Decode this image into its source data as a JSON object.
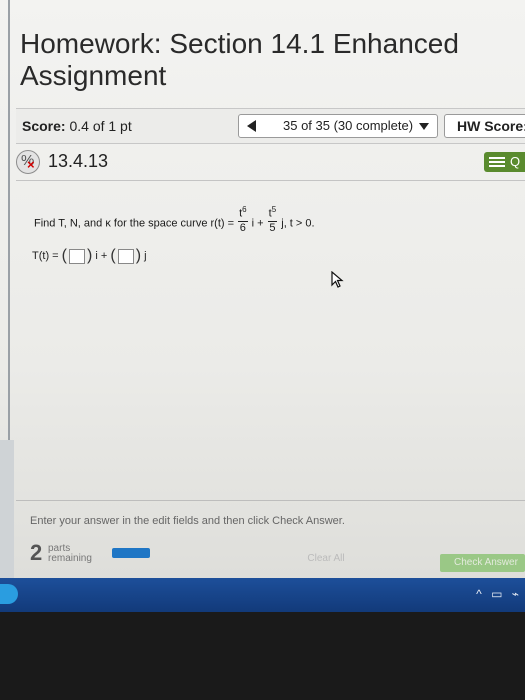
{
  "header": {
    "title": "Homework: Section 14.1 Enhanced Assignment"
  },
  "score_bar": {
    "score_label": "Score:",
    "score_value": "0.4 of 1 pt",
    "nav_text": "35 of 35 (30 complete)",
    "hw_score_label": "HW Score:"
  },
  "question": {
    "number": "13.4.13",
    "menu_label": "Q",
    "prompt_before": "Find T, N, and κ for the space curve r(t) =",
    "term1_num_base": "t",
    "term1_num_exp": "6",
    "term1_den": "6",
    "term1_vec": "i +",
    "term2_num_base": "t",
    "term2_num_exp": "5",
    "term2_den": "5",
    "term2_vec": "j, t > 0.",
    "answer_lhs": "T(t) =",
    "answer_mid": "i +",
    "answer_end": "j"
  },
  "footer": {
    "instruction": "Enter your answer in the edit fields and then click Check Answer.",
    "parts_count": "2",
    "parts_line1": "parts",
    "parts_line2": "remaining",
    "clear_all": "Clear All",
    "check_answer": "Check Answer"
  },
  "icons": {
    "prev": "triangle-left-icon",
    "dropdown": "caret-down-icon",
    "status": "partial-incorrect-icon",
    "menu": "hamburger-icon",
    "cursor": "mouse-pointer-icon"
  },
  "colors": {
    "menu_green": "#5a8b2e",
    "progress_blue": "#1f76c5",
    "check_green": "#6db94e",
    "taskbar_blue": "#1d4f9a"
  }
}
